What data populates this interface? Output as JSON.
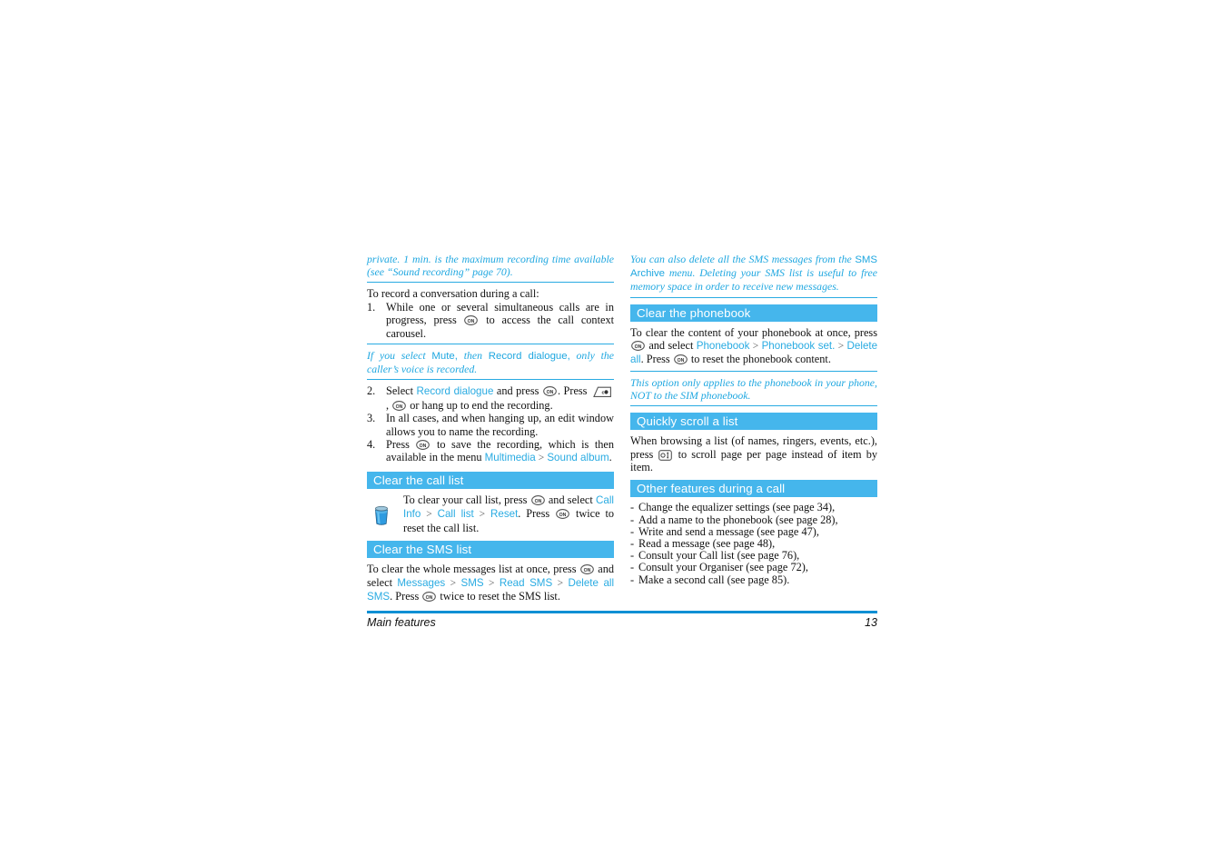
{
  "document": {
    "footer": {
      "chapter": "Main features",
      "page_number": "13"
    }
  },
  "left_column": {
    "note_top": {
      "text_part1": "private. 1 min. is the maximum recording time available (see “Sound recording” page 70)."
    },
    "intro": "To record a conversation during a call:",
    "steps": [
      {
        "num": "1.",
        "text_before": "While one or several simultaneous calls are in progress, press",
        "icon": "ok-key-icon",
        "text_after": "to access the call context carousel."
      },
      {
        "num": "2.",
        "text_before": "Select",
        "link": "Record dialogue",
        "text_mid": "and press",
        "icon": "ok-key-icon",
        "text_after_icon": ". Press",
        "icon2": "hangup-key-icon",
        "comma": ",",
        "icon3": "ok-key-icon",
        "text_after": "or hang up to end the recording."
      },
      {
        "num": "3.",
        "text": "In all cases, and when hanging up, an edit window allows you to name the recording."
      },
      {
        "num": "4.",
        "text_before": "Press",
        "icon": "ok-key-icon",
        "text_mid": "to save the recording, which is then available in the menu",
        "link1": "Multimedia",
        "separator": ">",
        "link2": "Sound album",
        "text_end": "."
      }
    ],
    "note_mute": {
      "part1_italic": "If you select",
      "part2_upright": "Mute,",
      "part3_italic": "then",
      "part4_upright": "Record dialogue,",
      "part5_italic": "only the caller’s voice is recorded."
    },
    "section_call_list": {
      "heading": "Clear the call list",
      "icon": "trash-bin-icon",
      "text_before": "To clear your call list, press",
      "icon1": "ok-key-icon",
      "text_mid": "and select",
      "link1": "Call Info",
      "sep1": ">",
      "link2": "Call list",
      "sep2": ">",
      "link3": "Reset",
      "text_after_links": ". Press",
      "icon2": "ok-key-icon",
      "text_end": "twice to reset the call list."
    },
    "section_sms_list": {
      "heading": "Clear the SMS list",
      "text_before": "To clear the whole messages list at once, press",
      "icon1": "ok-key-icon",
      "text_mid": "and select",
      "link1": "Messages",
      "sep1": ">",
      "link2": "SMS",
      "sep2": ">",
      "link3": "Read SMS",
      "sep3": ">",
      "link4": "Delete all SMS",
      "text_after_links": ". Press",
      "icon2": "ok-key-icon",
      "text_end": "twice to reset the SMS list."
    }
  },
  "right_column": {
    "note_sms_archive": {
      "part1_italic": "You can also delete all the SMS messages from the",
      "part2_upright": "SMS Archive",
      "part3_italic": "menu. Deleting your SMS list is useful to free memory space in order to receive new messages."
    },
    "section_phonebook": {
      "heading": "Clear the phonebook",
      "text_before": "To clear the content of your phonebook at once, press",
      "icon1": "ok-key-icon",
      "text_mid": "and select",
      "link1": "Phonebook",
      "sep1": ">",
      "link2": "Phonebook set.",
      "sep2": ">",
      "link3": "Delete all",
      "text_after_links": ". Press",
      "icon2": "ok-key-icon",
      "text_end": "to reset the phonebook content."
    },
    "note_sim": {
      "text": "This option only applies to the phonebook in your phone, NOT to the SIM phonebook."
    },
    "section_scroll": {
      "heading": "Quickly scroll a list",
      "text_before": "When browsing a list (of names, ringers, events, etc.), press",
      "icon": "nav-key-icon",
      "text_after": "to scroll page per page instead of item by item."
    },
    "section_other_features": {
      "heading": "Other features during a call",
      "items": [
        "Change the equalizer settings (see page 34),",
        "Add a name to the phonebook (see page 28),",
        "Write and send a message (see page 47),",
        "Read a message (see page 48),",
        "Consult your Call list (see page 76),",
        "Consult your Organiser (see page 72),",
        "Make a second call (see page 85)."
      ]
    }
  },
  "colors": {
    "section_bar": "#45B6EC",
    "link": "#29ABE2",
    "note": "#1FA7E0",
    "footer_rule": "#0F8FD4"
  }
}
